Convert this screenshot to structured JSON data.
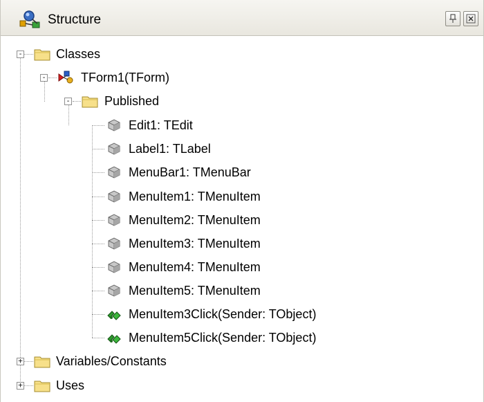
{
  "panel": {
    "title": "Structure"
  },
  "tree": {
    "classes": "Classes",
    "form": "TForm1(TForm)",
    "published": "Published",
    "members": [
      "Edit1: TEdit",
      "Label1: TLabel",
      "MenuBar1: TMenuBar",
      "MenuItem1: TMenuItem",
      "MenuItem2: TMenuItem",
      "MenuItem3: TMenuItem",
      "MenuItem4: TMenuItem",
      "MenuItem5: TMenuItem"
    ],
    "methods": [
      "MenuItem3Click(Sender: TObject)",
      "MenuItem5Click(Sender: TObject)"
    ],
    "variables": "Variables/Constants",
    "uses": "Uses"
  },
  "icons": {
    "folder": "folder-icon",
    "class": "class-icon",
    "field": "field-icon",
    "method": "method-icon",
    "title": "structure-icon"
  },
  "expander_states": {
    "classes": "-",
    "form": "-",
    "published": "-",
    "variables": "+",
    "uses": "+"
  }
}
